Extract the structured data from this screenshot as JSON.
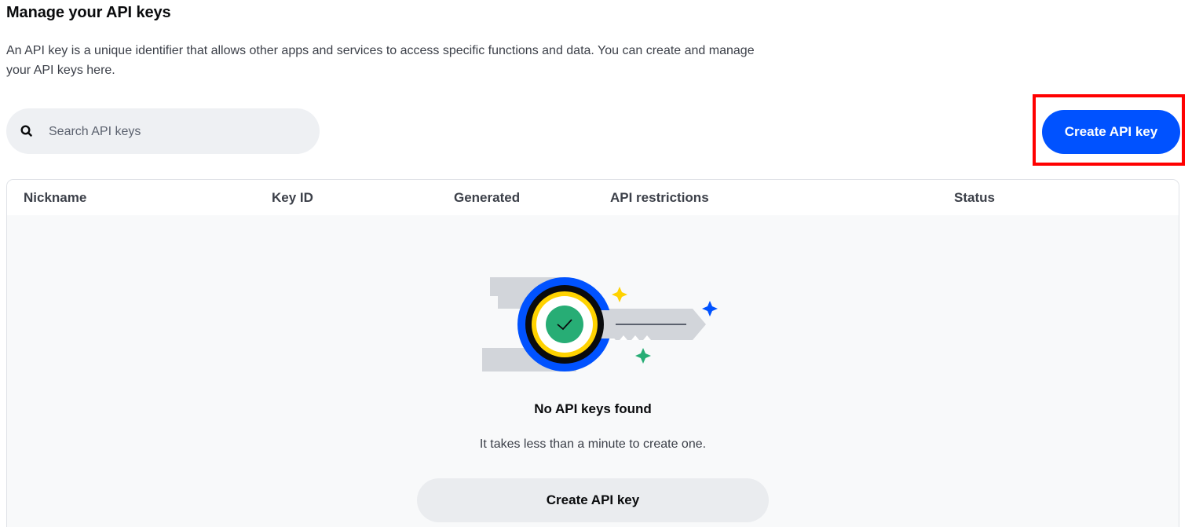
{
  "header": {
    "title": "Manage your API keys",
    "description": "An API key is a unique identifier that allows other apps and services to access specific functions and data. You can create and manage your API keys here."
  },
  "search": {
    "placeholder": "Search API keys",
    "value": "",
    "icon": "search-icon"
  },
  "toolbar": {
    "create_label": "Create API key"
  },
  "table": {
    "columns": [
      "Nickname",
      "Key ID",
      "Generated",
      "API restrictions",
      "Status"
    ]
  },
  "empty_state": {
    "illustration": "key-check-illustration",
    "title": "No API keys found",
    "subtitle": "It takes less than a minute to create one.",
    "button_label": "Create API key"
  },
  "colors": {
    "primary": "#0052ff",
    "highlight": "#ff0000",
    "accent_yellow": "#ffd200",
    "accent_green": "#27ad75"
  }
}
